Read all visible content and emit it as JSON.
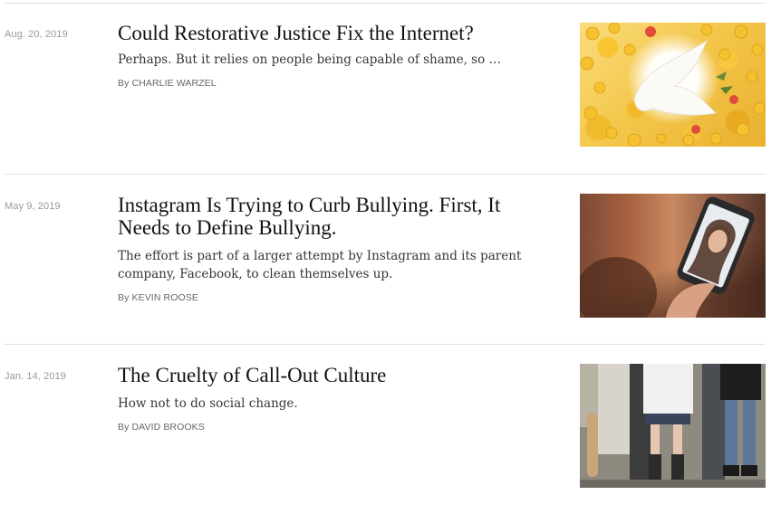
{
  "articles": [
    {
      "date": "Aug. 20, 2019",
      "headline": "Could Restorative Justice Fix the Internet?",
      "summary": "Perhaps. But it relies on people being capable of shame, so …",
      "byline_prefix": "By",
      "author": "Charlie Warzel",
      "image_subject": "dove-surrounded-by-emojis"
    },
    {
      "date": "May 9, 2019",
      "headline": "Instagram Is Trying to Curb Bullying. First, It Needs to Define Bullying.",
      "summary": "The effort is part of a larger attempt by Instagram and its parent company, Facebook, to clean themselves up.",
      "byline_prefix": "By",
      "author": "Kevin Roose",
      "image_subject": "person-holding-phone"
    },
    {
      "date": "Jan. 14, 2019",
      "headline": "The Cruelty of Call-Out Culture",
      "summary": "How not to do social change.",
      "byline_prefix": "By",
      "author": "David Brooks",
      "image_subject": "crowd-legs"
    }
  ],
  "colors": {
    "headline": "#121212",
    "summary": "#363636",
    "date": "#999999",
    "byline": "#666666",
    "divider": "#e2e2e2"
  }
}
